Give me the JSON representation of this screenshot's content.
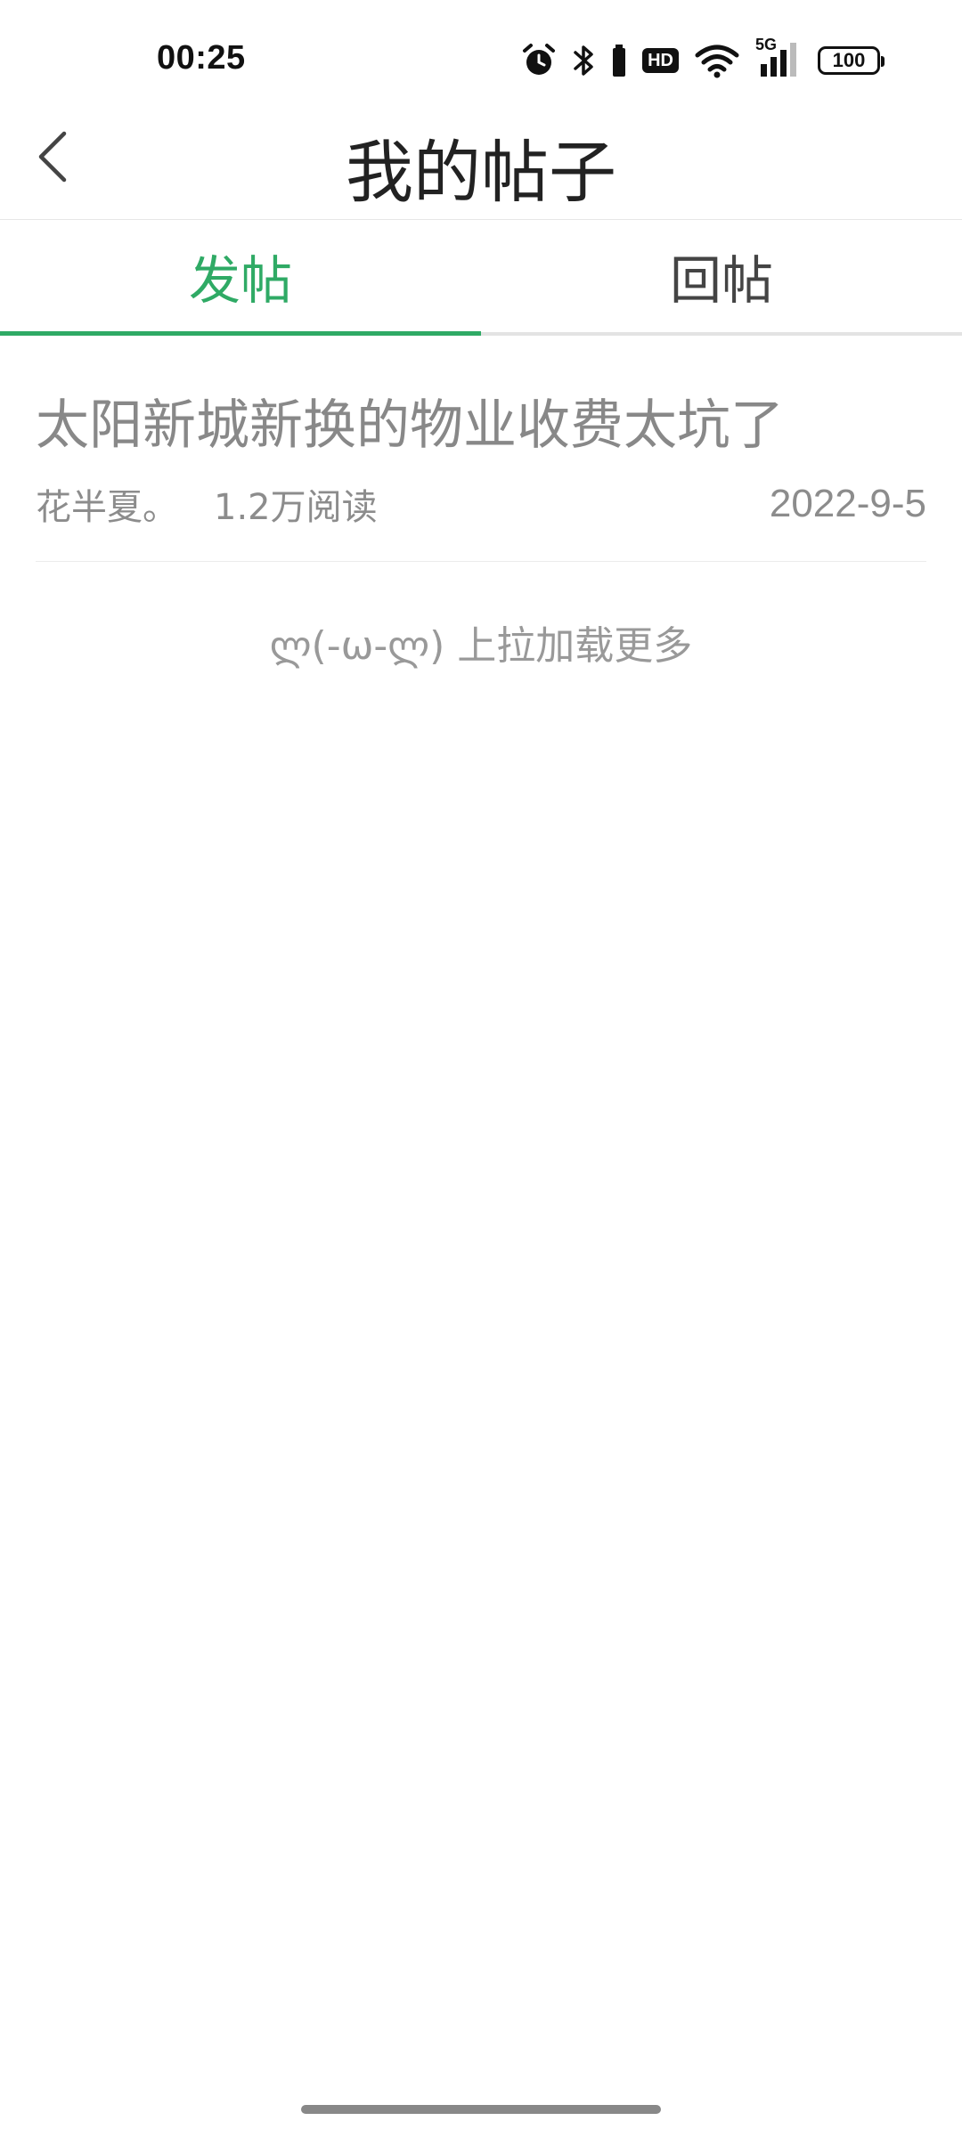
{
  "status_bar": {
    "time": "00:25",
    "hd_label": "HD",
    "network_label": "5G",
    "battery_level": "100"
  },
  "header": {
    "title": "我的帖子"
  },
  "tabs": [
    {
      "label": "发帖",
      "active": true
    },
    {
      "label": "回帖",
      "active": false
    }
  ],
  "posts": [
    {
      "title": "太阳新城新换的物业收费太坑了",
      "author": "花半夏。",
      "reads": "1.2万阅读",
      "date": "2022-9-5"
    }
  ],
  "load_more_text": "ლ(-ω-ლ) 上拉加载更多",
  "colors": {
    "accent": "#2faa65",
    "muted_text": "#888888"
  }
}
